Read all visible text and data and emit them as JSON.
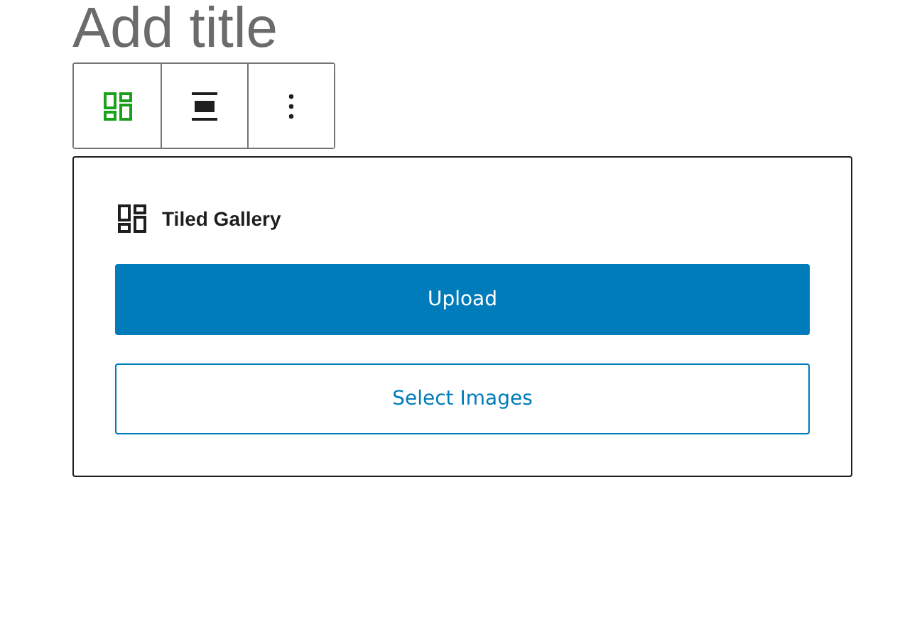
{
  "title": {
    "placeholder": "Add title"
  },
  "toolbar": [
    {
      "kind": "gallery",
      "selected": true
    },
    {
      "kind": "align",
      "selected": false
    },
    {
      "kind": "more",
      "selected": false
    }
  ],
  "block": {
    "name": "Tiled Gallery",
    "buttons": [
      {
        "label": "Upload",
        "kind": "primary"
      },
      {
        "label": "Select Images",
        "kind": "secondary"
      }
    ]
  }
}
